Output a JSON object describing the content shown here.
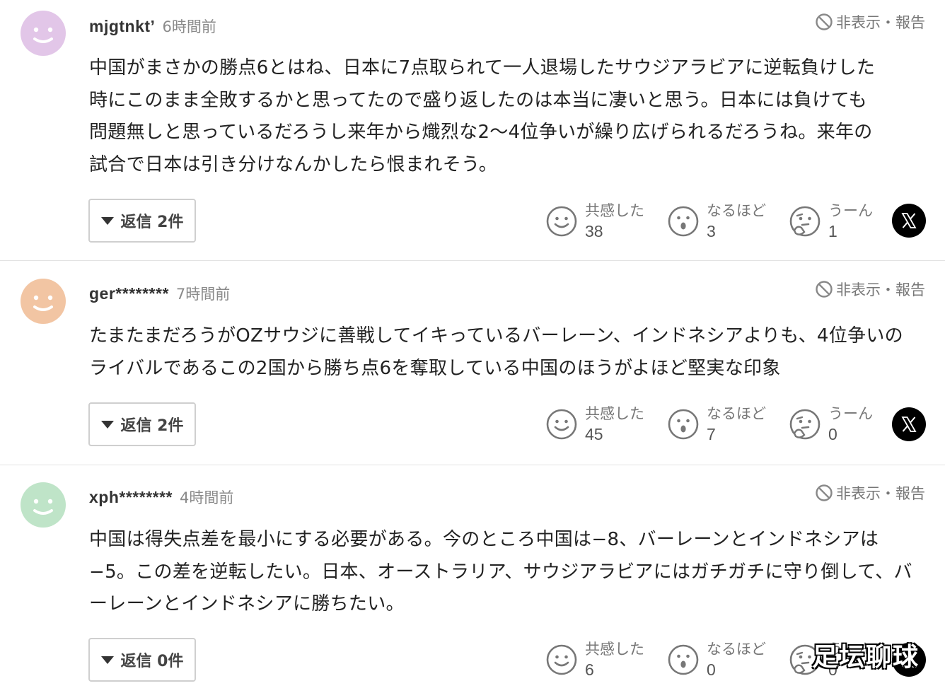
{
  "hide_report_label": "非表示・報告",
  "reaction_labels": {
    "empathy": "共感した",
    "agree": "なるほど",
    "hmm": "うーん"
  },
  "comments": [
    {
      "avatar_color": "#e2c6e8",
      "user": "mjgtnkt’",
      "time": "6時間前",
      "lines": [
        "中国がまさかの勝点6とはね、日本に7点取られて一人退場したサウジアラビアに逆転負けした",
        "時にこのまま全敗するかと思ってたので盛り返したのは本当に凄いと思う。日本には負けても",
        "問題無しと思っているだろうし来年から熾烈な2〜4位争いが繰り広げられるだろうね。来年の",
        "試合で日本は引き分けなんかしたら恨まれそう。"
      ],
      "reply_label": "返信 2件",
      "empathy": "38",
      "agree": "3",
      "hmm": "1"
    },
    {
      "avatar_color": "#f2c5a3",
      "user": "ger********",
      "time": "7時間前",
      "lines": [
        "たまたまだろうがOZサウジに善戦してイキっているバーレーン、インドネシアよりも、4位争いの",
        "ライバルであるこの2国から勝ち点6を奪取している中国のほうがよほど堅実な印象"
      ],
      "reply_label": "返信 2件",
      "empathy": "45",
      "agree": "7",
      "hmm": "0"
    },
    {
      "avatar_color": "#bfe4c8",
      "user": "xph********",
      "time": "4時間前",
      "lines": [
        "中国は得失点差を最小にする必要がある。今のところ中国は−8、バーレーンとインドネシアは",
        "−5。この差を逆転したい。日本、オーストラリア、サウジアラビアにはガチガチに守り倒して、バ",
        "ーレーンとインドネシアに勝ちたい。"
      ],
      "reply_label": "返信 0件",
      "empathy": "6",
      "agree": "0",
      "hmm": "0"
    }
  ],
  "watermark": "足坛聊球"
}
